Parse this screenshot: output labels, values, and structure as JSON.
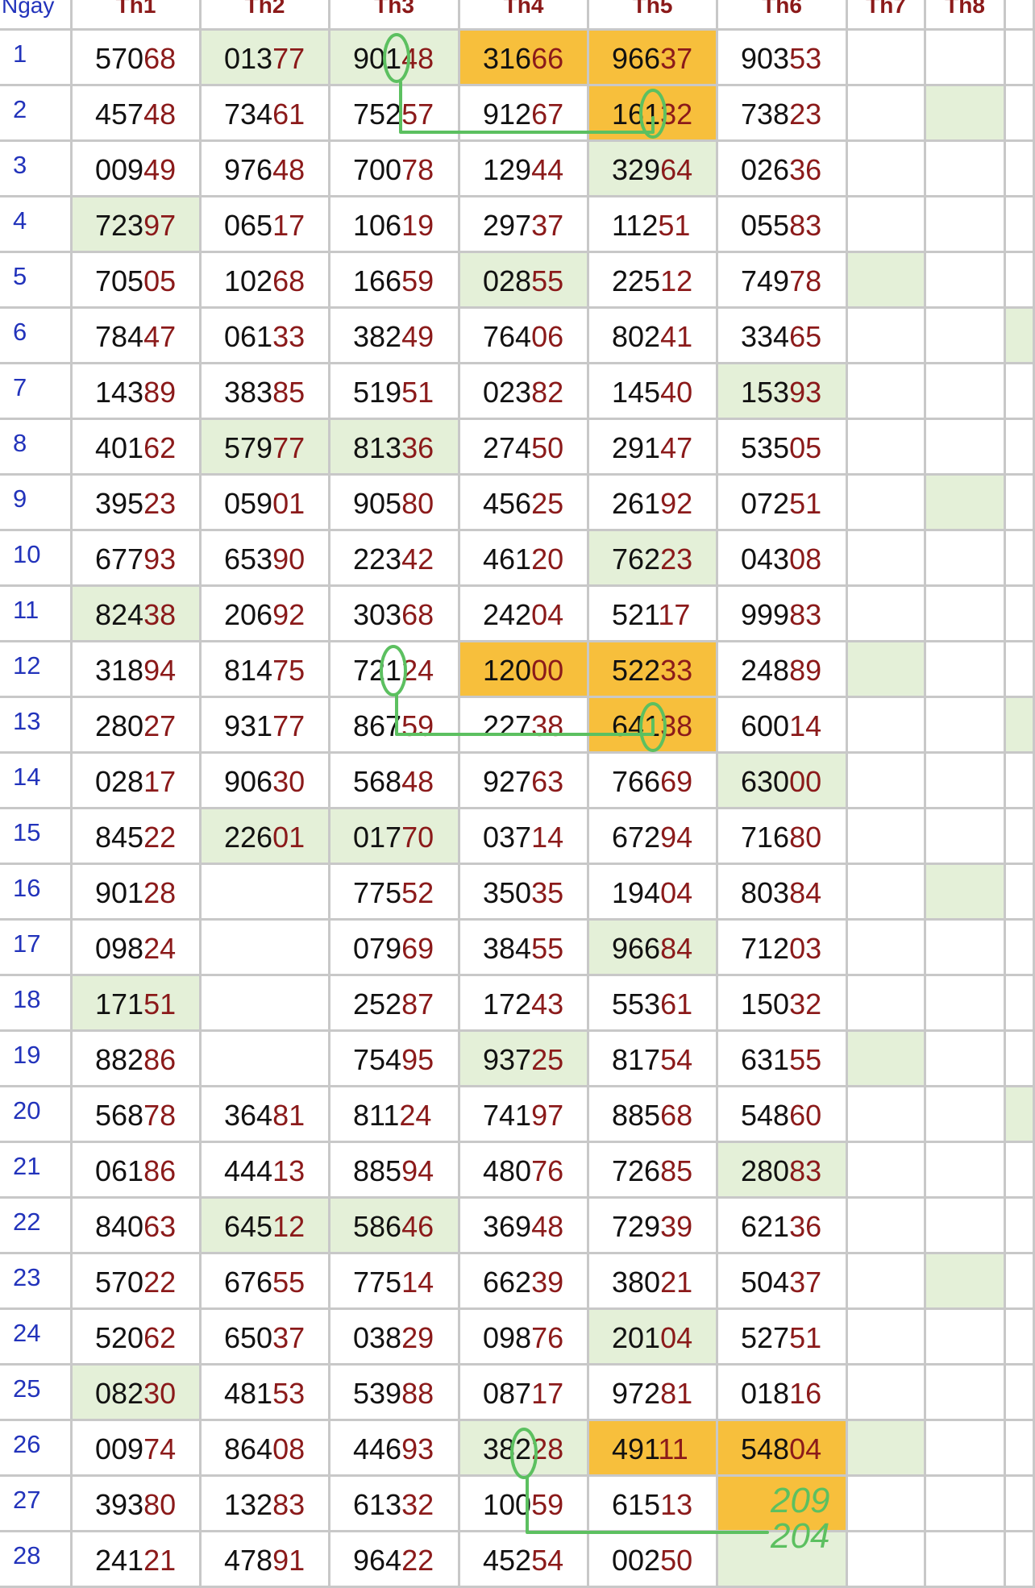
{
  "palette": {
    "green": "#e4f0d8",
    "orange": "#f7bf3c",
    "tail": "#8b1a1a",
    "day": "#2233bb",
    "marker": "#5cc060"
  },
  "headers": [
    "Ngay",
    "Th1",
    "Th2",
    "Th3",
    "Th4",
    "Th5",
    "Th6",
    "Th7",
    "Th8"
  ],
  "rows": [
    {
      "day": "1",
      "cells": [
        "57068",
        "01377",
        "90148",
        "31666",
        "96637",
        "90353",
        "",
        ""
      ]
    },
    {
      "day": "2",
      "cells": [
        "45748",
        "73461",
        "75257",
        "91267",
        "16132",
        "73823",
        "",
        ""
      ]
    },
    {
      "day": "3",
      "cells": [
        "00949",
        "97648",
        "70078",
        "12944",
        "32964",
        "02636",
        "",
        ""
      ]
    },
    {
      "day": "4",
      "cells": [
        "72397",
        "06517",
        "10619",
        "29737",
        "11251",
        "05583",
        "",
        ""
      ]
    },
    {
      "day": "5",
      "cells": [
        "70505",
        "10268",
        "16659",
        "02855",
        "22512",
        "74978",
        "",
        ""
      ]
    },
    {
      "day": "6",
      "cells": [
        "78447",
        "06133",
        "38249",
        "76406",
        "80241",
        "33465",
        "",
        ""
      ]
    },
    {
      "day": "7",
      "cells": [
        "14389",
        "38385",
        "51951",
        "02382",
        "14540",
        "15393",
        "",
        ""
      ]
    },
    {
      "day": "8",
      "cells": [
        "40162",
        "57977",
        "81336",
        "27450",
        "29147",
        "53505",
        "",
        ""
      ]
    },
    {
      "day": "9",
      "cells": [
        "39523",
        "05901",
        "90580",
        "45625",
        "26192",
        "07251",
        "",
        ""
      ]
    },
    {
      "day": "10",
      "cells": [
        "67793",
        "65390",
        "22342",
        "46120",
        "76223",
        "04308",
        "",
        ""
      ]
    },
    {
      "day": "11",
      "cells": [
        "82438",
        "20692",
        "30368",
        "24204",
        "52117",
        "99983",
        "",
        ""
      ]
    },
    {
      "day": "12",
      "cells": [
        "31894",
        "81475",
        "72124",
        "12000",
        "52233",
        "24889",
        "",
        ""
      ]
    },
    {
      "day": "13",
      "cells": [
        "28027",
        "93177",
        "86759",
        "22738",
        "64138",
        "60014",
        "",
        ""
      ]
    },
    {
      "day": "14",
      "cells": [
        "02817",
        "90630",
        "56848",
        "92763",
        "76669",
        "63000",
        "",
        ""
      ]
    },
    {
      "day": "15",
      "cells": [
        "84522",
        "22601",
        "01770",
        "03714",
        "67294",
        "71680",
        "",
        ""
      ]
    },
    {
      "day": "16",
      "cells": [
        "90128",
        "",
        "77552",
        "35035",
        "19404",
        "80384",
        "",
        ""
      ]
    },
    {
      "day": "17",
      "cells": [
        "09824",
        "",
        "07969",
        "38455",
        "96684",
        "71203",
        "",
        ""
      ]
    },
    {
      "day": "18",
      "cells": [
        "17151",
        "",
        "25287",
        "17243",
        "55361",
        "15032",
        "",
        ""
      ]
    },
    {
      "day": "19",
      "cells": [
        "88286",
        "",
        "75495",
        "93725",
        "81754",
        "63155",
        "",
        ""
      ]
    },
    {
      "day": "20",
      "cells": [
        "56878",
        "36481",
        "81124",
        "74197",
        "88568",
        "54860",
        "",
        ""
      ]
    },
    {
      "day": "21",
      "cells": [
        "06186",
        "44413",
        "88594",
        "48076",
        "72685",
        "28083",
        "",
        ""
      ]
    },
    {
      "day": "22",
      "cells": [
        "84063",
        "64512",
        "58646",
        "36948",
        "72939",
        "62136",
        "",
        ""
      ]
    },
    {
      "day": "23",
      "cells": [
        "57022",
        "67655",
        "77514",
        "66239",
        "38021",
        "50437",
        "",
        ""
      ]
    },
    {
      "day": "24",
      "cells": [
        "52062",
        "65037",
        "03829",
        "09876",
        "20104",
        "52751",
        "",
        ""
      ]
    },
    {
      "day": "25",
      "cells": [
        "08230",
        "48153",
        "53988",
        "08717",
        "97281",
        "01816",
        "",
        ""
      ]
    },
    {
      "day": "26",
      "cells": [
        "00974",
        "86408",
        "44693",
        "38228",
        "49111",
        "54804",
        "",
        ""
      ]
    },
    {
      "day": "27",
      "cells": [
        "39380",
        "13283",
        "61332",
        "10059",
        "61513",
        "",
        "",
        ""
      ]
    },
    {
      "day": "28",
      "cells": [
        "24121",
        "47891",
        "96422",
        "45254",
        "00250",
        "",
        "",
        ""
      ]
    }
  ],
  "highlights": {
    "green": [
      [
        1,
        2
      ],
      [
        1,
        3
      ],
      [
        2,
        8
      ],
      [
        3,
        5
      ],
      [
        4,
        1
      ],
      [
        5,
        4
      ],
      [
        5,
        7
      ],
      [
        6,
        9
      ],
      [
        7,
        6
      ],
      [
        8,
        2
      ],
      [
        8,
        3
      ],
      [
        9,
        8
      ],
      [
        10,
        5
      ],
      [
        11,
        1
      ],
      [
        12,
        7
      ],
      [
        13,
        9
      ],
      [
        14,
        6
      ],
      [
        15,
        2
      ],
      [
        15,
        3
      ],
      [
        16,
        8
      ],
      [
        17,
        5
      ],
      [
        18,
        1
      ],
      [
        19,
        4
      ],
      [
        19,
        7
      ],
      [
        20,
        9
      ],
      [
        21,
        6
      ],
      [
        22,
        2
      ],
      [
        22,
        3
      ],
      [
        23,
        8
      ],
      [
        24,
        5
      ],
      [
        25,
        1
      ],
      [
        26,
        4
      ],
      [
        26,
        7
      ],
      [
        28,
        6
      ]
    ],
    "orange": [
      [
        1,
        4
      ],
      [
        1,
        5
      ],
      [
        2,
        5
      ],
      [
        12,
        4
      ],
      [
        12,
        5
      ],
      [
        13,
        5
      ],
      [
        26,
        5
      ],
      [
        26,
        6
      ],
      [
        27,
        6
      ]
    ]
  },
  "annotations": {
    "note_line_1": "209",
    "note_line_2": "204"
  }
}
